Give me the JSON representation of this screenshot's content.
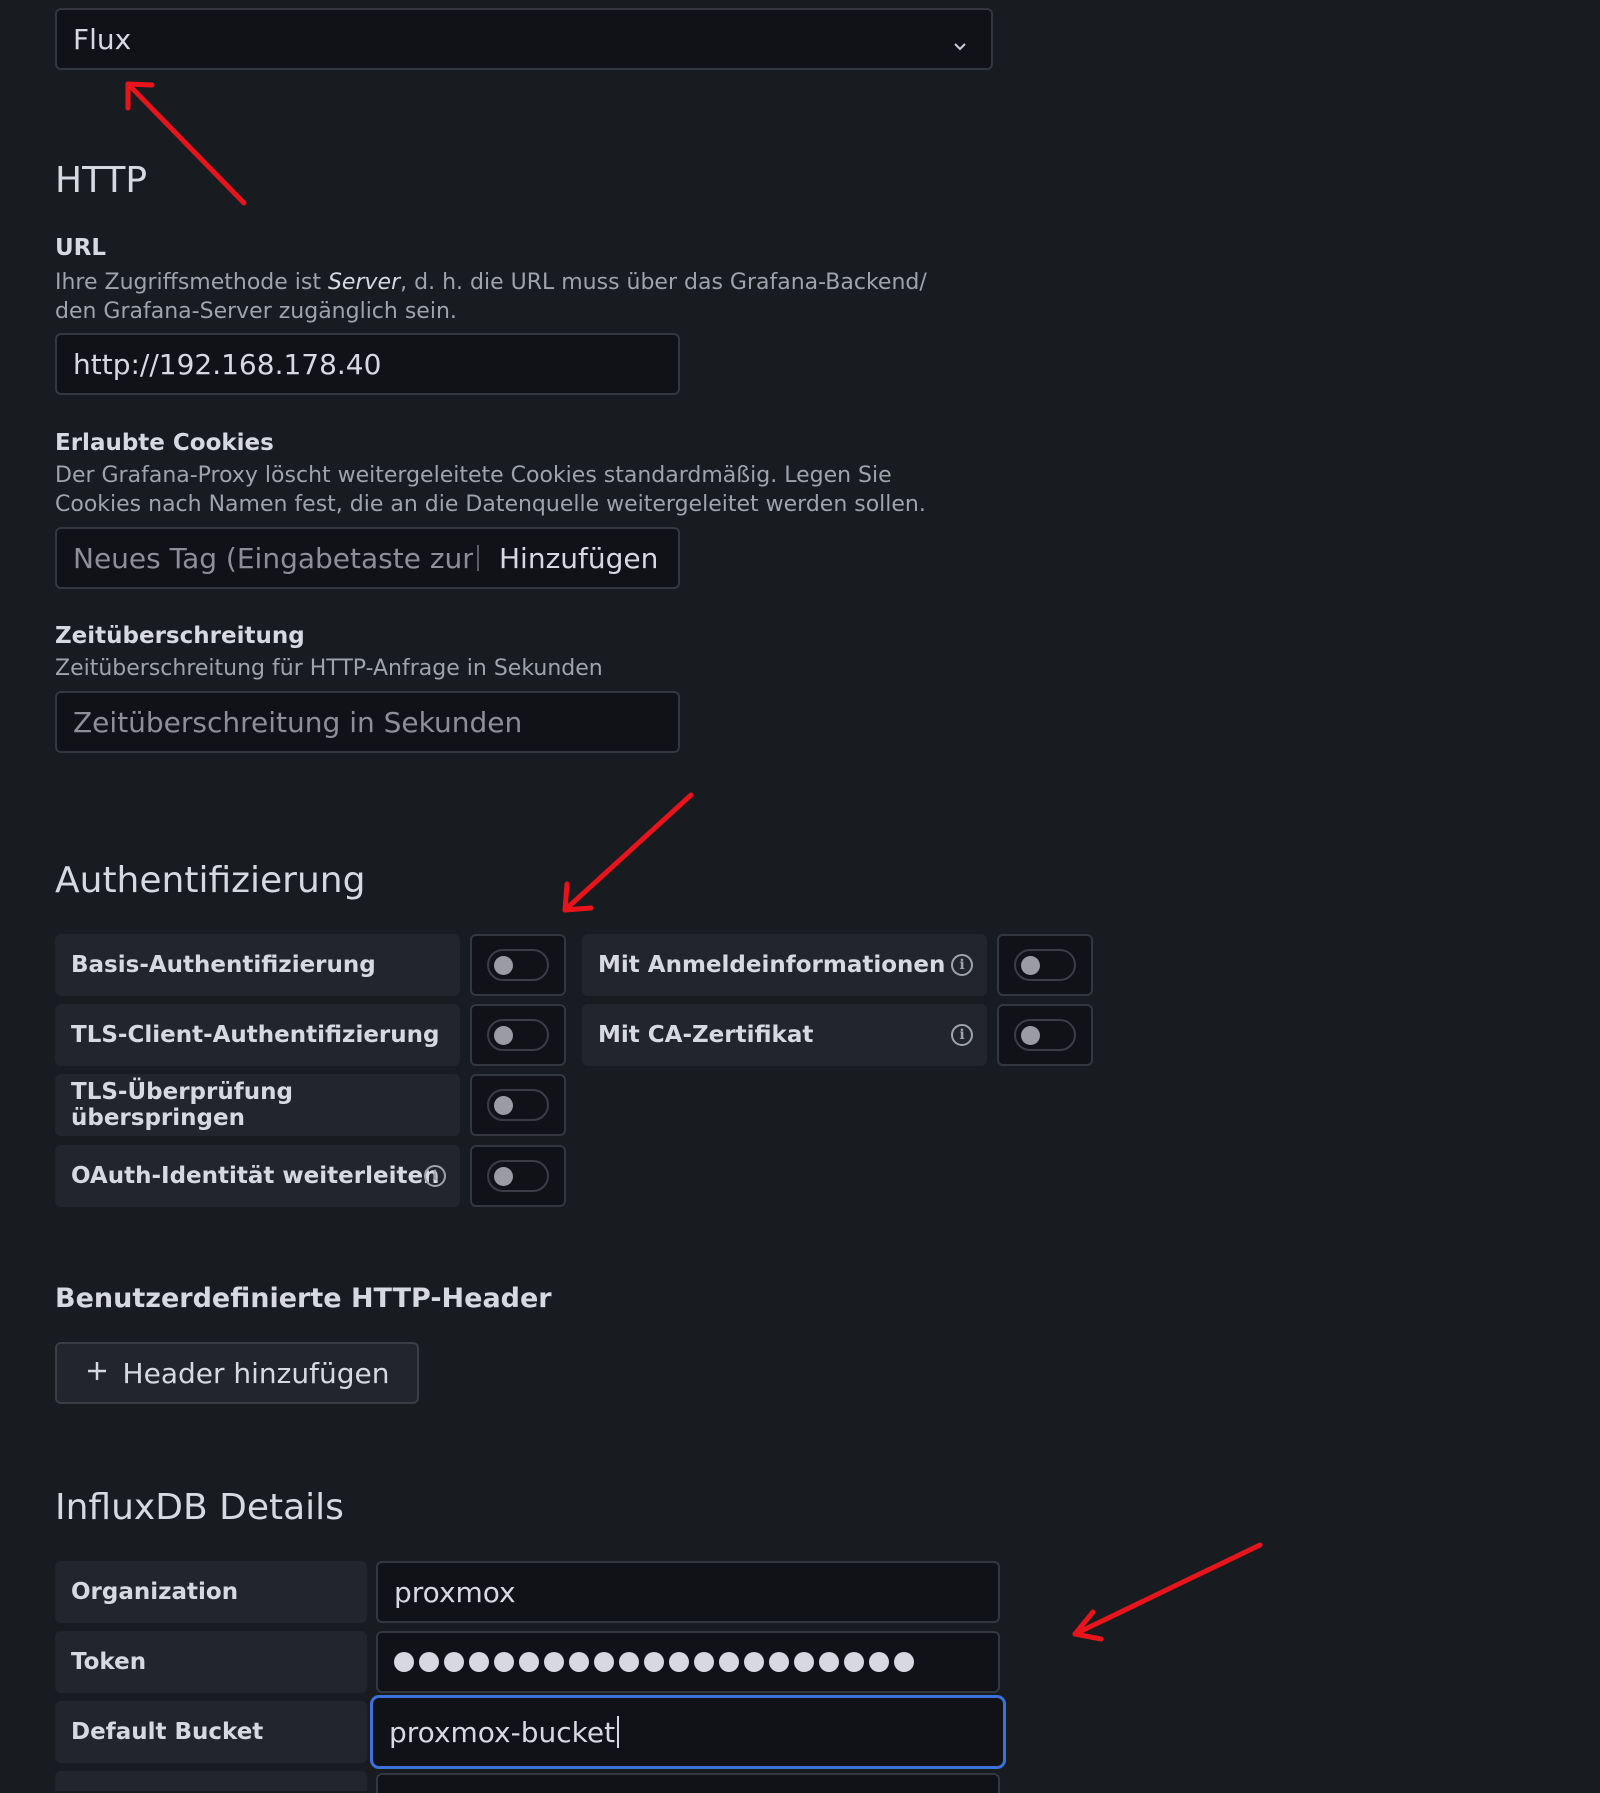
{
  "query_language": {
    "selected": "Flux"
  },
  "http": {
    "heading": "HTTP",
    "url": {
      "label": "URL",
      "desc_pre": "Ihre Zugriffsmethode ist ",
      "desc_em": "Server",
      "desc_post": ", d. h. die URL muss über das Grafana-Backend/",
      "desc_line2": "den Grafana-Server zugänglich sein.",
      "value": "http://192.168.178.40"
    },
    "cookies": {
      "label": "Erlaubte Cookies",
      "desc_line1": "Der Grafana-Proxy löscht weitergeleitete Cookies standardmäßig. Legen Sie",
      "desc_line2": "Cookies nach Namen fest, die an die Datenquelle weitergeleitet werden sollen.",
      "placeholder": "Neues Tag (Eingabetaste zum Hinzufügen)",
      "add_label": "Hinzufügen"
    },
    "timeout": {
      "label": "Zeitüberschreitung",
      "desc": "Zeitüberschreitung für HTTP-Anfrage in Sekunden",
      "placeholder": "Zeitüberschreitung in Sekunden"
    }
  },
  "auth": {
    "heading": "Authentifizierung",
    "basic": {
      "label": "Basis-Authentifizierung",
      "enabled": false
    },
    "tls_client": {
      "label": "TLS-Client-Authentifizierung",
      "enabled": false
    },
    "tls_skip": {
      "label": "TLS-Überprüfung überspringen",
      "enabled": false
    },
    "oauth": {
      "label": "OAuth-Identität weiterleiten",
      "enabled": false
    },
    "with_credentials": {
      "label": "Mit Anmeldeinformationen",
      "enabled": false
    },
    "with_ca": {
      "label": "Mit CA-Zertifikat",
      "enabled": false
    }
  },
  "custom_headers": {
    "heading": "Benutzerdefinierte HTTP-Header",
    "add_button": "Header hinzufügen"
  },
  "influx": {
    "heading": "InfluxDB Details",
    "organization": {
      "label": "Organization",
      "value": "proxmox"
    },
    "token": {
      "label": "Token",
      "mask_count": 21
    },
    "default_bucket": {
      "label": "Default Bucket",
      "value": "proxmox-bucket"
    }
  },
  "colors": {
    "background": "#181b1f",
    "input_bg": "#111217",
    "focus": "#3d71d9",
    "annotation_arrow": "#e8141b"
  }
}
